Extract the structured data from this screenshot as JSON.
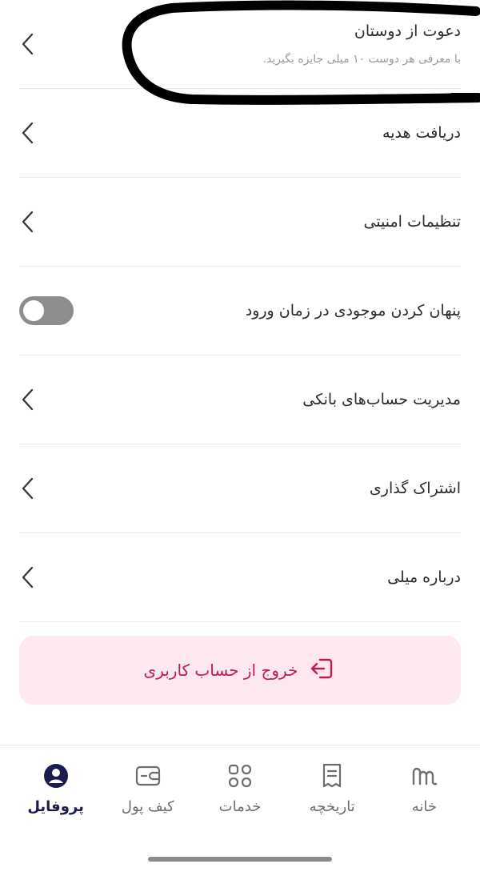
{
  "menu": {
    "items": [
      {
        "title": "دعوت از دوستان",
        "subtitle": "با معرفی هر دوست ۱۰ میلی جایزه بگیرید.",
        "control": "chevron"
      },
      {
        "title": "دریافت هدیه",
        "control": "chevron"
      },
      {
        "title": "تنظیمات امنیتی",
        "control": "chevron"
      },
      {
        "title": "پنهان کردن موجودی در زمان ورود",
        "control": "toggle",
        "toggle_on": false
      },
      {
        "title": "مدیریت حساب‌های بانکی",
        "control": "chevron"
      },
      {
        "title": "اشتراک گذاری",
        "control": "chevron"
      },
      {
        "title": "درباره میلی",
        "control": "chevron"
      }
    ]
  },
  "logout": {
    "label": "خروج از حساب کاربری",
    "background": "#fde8ee",
    "color": "#c2185b"
  },
  "bottom_nav": {
    "items": [
      {
        "label": "خانه",
        "icon": "home-logo-icon",
        "active": false
      },
      {
        "label": "تاریخچه",
        "icon": "receipt-icon",
        "active": false
      },
      {
        "label": "خدمات",
        "icon": "grid-icon",
        "active": false
      },
      {
        "label": "کیف پول",
        "icon": "wallet-icon",
        "active": false
      },
      {
        "label": "پروفایل",
        "icon": "profile-icon",
        "active": true
      }
    ],
    "active_color": "#1c1b4d"
  }
}
